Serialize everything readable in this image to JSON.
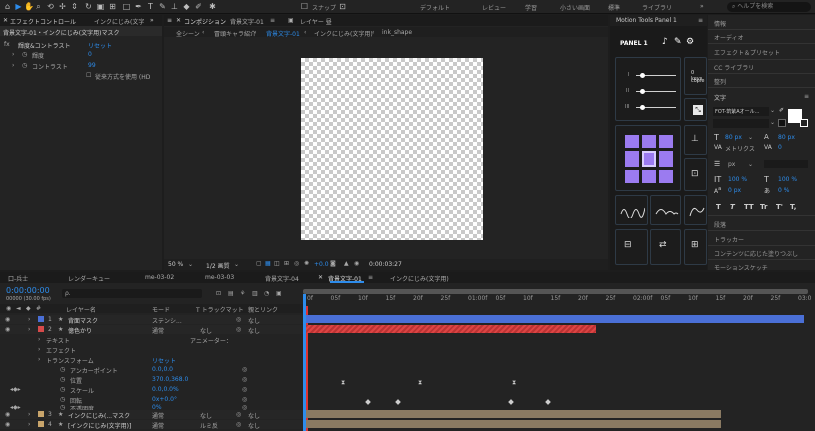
{
  "toolbar": {
    "snap_label": "スナップ",
    "workspaces": [
      "デフォルト",
      "レビュー",
      "学習",
      "小さい画面",
      "標準",
      "ライブラリ"
    ],
    "help_placeholder": "ヘルプを検索"
  },
  "effects_panel": {
    "tab": "エフェクトコントロール",
    "tab_layer": "インクにじみ(文字",
    "layer_path": "背景文字-01・インクにじみ(文字用)マスク",
    "effect_name": "輝度&コントラスト",
    "reset": "リセット",
    "props": [
      {
        "name": "輝度",
        "value": "0"
      },
      {
        "name": "コントラスト",
        "value": "99"
      }
    ],
    "legacy_label": "従来方式を使用 (HD"
  },
  "comp_panel": {
    "tab": "コンポジション",
    "tab_name": "背景文字-01",
    "layer_tab": "レイヤー 昼",
    "breadcrumbs": [
      "全シーン",
      "冒頭キャラ紹介",
      "背景文字-01",
      "インクにじみ(文字用)",
      "ink_shape"
    ],
    "zoom": "50 %",
    "resolution": "1/2 画質",
    "exposure": "+0.0",
    "timecode": "0:00:03:27"
  },
  "motion_panel": {
    "title": "Motion Tools Panel 1",
    "section": "PANEL 1",
    "slider_labels": [
      "I",
      "II",
      "III"
    ],
    "keys_text": "0 keys",
    "copied_text": "copie"
  },
  "right_panel": {
    "items_top": [
      "情報",
      "オーディオ",
      "エフェクト＆プリセット",
      "CC ライブラリ",
      "整列"
    ],
    "text_section": "文字",
    "font": "FOT-筑紫Aオール...",
    "font_size": "80 px",
    "leading": "80 px",
    "tracking": "0",
    "tracking_label": "メトリクス",
    "px_unit": "px",
    "vscale": "100 %",
    "hscale": "100 %",
    "baseline": "0 px",
    "tsume": "0 %",
    "styles": [
      "T",
      "T",
      "TT",
      "Tr",
      "T'",
      "T,"
    ],
    "items_bottom": [
      "段落",
      "トラッカー",
      "コンテンツに応じた塗りつぶし",
      "モーションスケッチ"
    ]
  },
  "timeline": {
    "tabs": [
      "口-兵士",
      "レンダーキュー",
      "me-03-02",
      "me-03-03",
      "背景文字-04",
      "背景文字-01",
      "インクにじみ(文字用)"
    ],
    "active_tab": "背景文字-01",
    "timecode": "0:00:00:00",
    "timecode_sub": "00000 (30.00 fps)",
    "search_placeholder": "ρ.",
    "columns": {
      "name": "レイヤー名",
      "mode": "モード",
      "trkmat": "T トラックマット",
      "parent": "親とリンク"
    },
    "ruler": [
      "0f",
      "05f",
      "10f",
      "15f",
      "20f",
      "25f",
      "01:00f",
      "05f",
      "10f",
      "15f",
      "20f",
      "25f",
      "02:00f",
      "05f",
      "10f",
      "15f",
      "20f",
      "25f",
      "03:0"
    ],
    "layers": [
      {
        "num": "1",
        "name": "背面マスク",
        "mode": "ステンシ...",
        "trkmat": "",
        "parent": "なし",
        "color": "#4a6fd6"
      },
      {
        "num": "2",
        "name": "億色かり",
        "mode": "通常",
        "trkmat": "なし",
        "parent": "なし",
        "color": "#d64a4a"
      },
      {
        "num": "3",
        "name": "インクにじみ(...マスク",
        "mode": "通常",
        "trkmat": "なし",
        "parent": "なし",
        "color": "#c9a56b"
      },
      {
        "num": "4",
        "name": "[インクにじみ(文字用)]",
        "mode": "通常",
        "trkmat": "ルミ反",
        "parent": "なし",
        "color": "#c9a56b"
      }
    ],
    "sub_rows": {
      "text": "テキスト",
      "animator": "アニメーター：",
      "effects": "エフェクト",
      "transform": "トランスフォーム",
      "reset": "リセット",
      "anchor": "アンカーポイント",
      "anchor_val": "0.0,0.0",
      "position": "位置",
      "position_val": "370.0,368.0",
      "scale": "スケール",
      "scale_val": "0.0,0.0%",
      "rotation": "回転",
      "rotation_val": "0x+0.0°",
      "opacity": "不透明度",
      "opacity_val": "0%"
    }
  }
}
